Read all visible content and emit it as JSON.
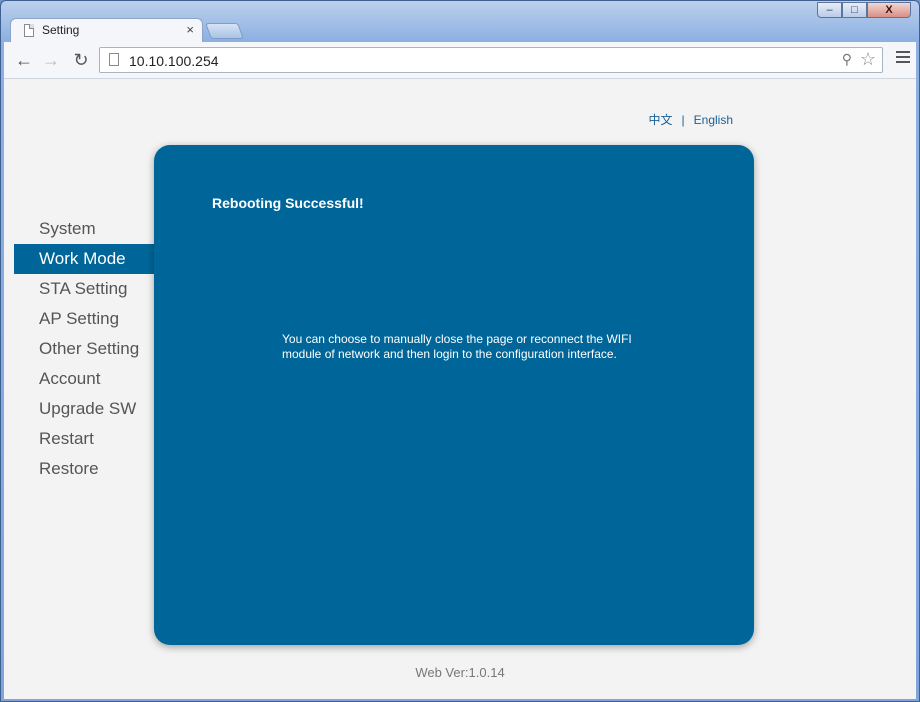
{
  "browser": {
    "tab_title": "Setting",
    "tab_close": "×",
    "url": "10.10.100.254",
    "caption": {
      "minimize": "–",
      "maximize": "□",
      "close": "X"
    }
  },
  "lang": {
    "chinese": "中文",
    "separator": "|",
    "english": "English"
  },
  "sidebar": {
    "items": [
      {
        "label": "System"
      },
      {
        "label": "Work Mode"
      },
      {
        "label": "STA Setting"
      },
      {
        "label": "AP Setting"
      },
      {
        "label": "Other Setting"
      },
      {
        "label": "Account"
      },
      {
        "label": "Upgrade SW"
      },
      {
        "label": "Restart"
      },
      {
        "label": "Restore"
      }
    ],
    "active": "Work Mode"
  },
  "panel": {
    "heading": "Rebooting Successful!",
    "message": "You can choose to manually close the page or reconnect the WIFI module of network and then login to the configuration interface."
  },
  "footer": {
    "version": "Web Ver:1.0.14"
  },
  "colors": {
    "accent": "#006699",
    "background": "#f3f3f3"
  }
}
